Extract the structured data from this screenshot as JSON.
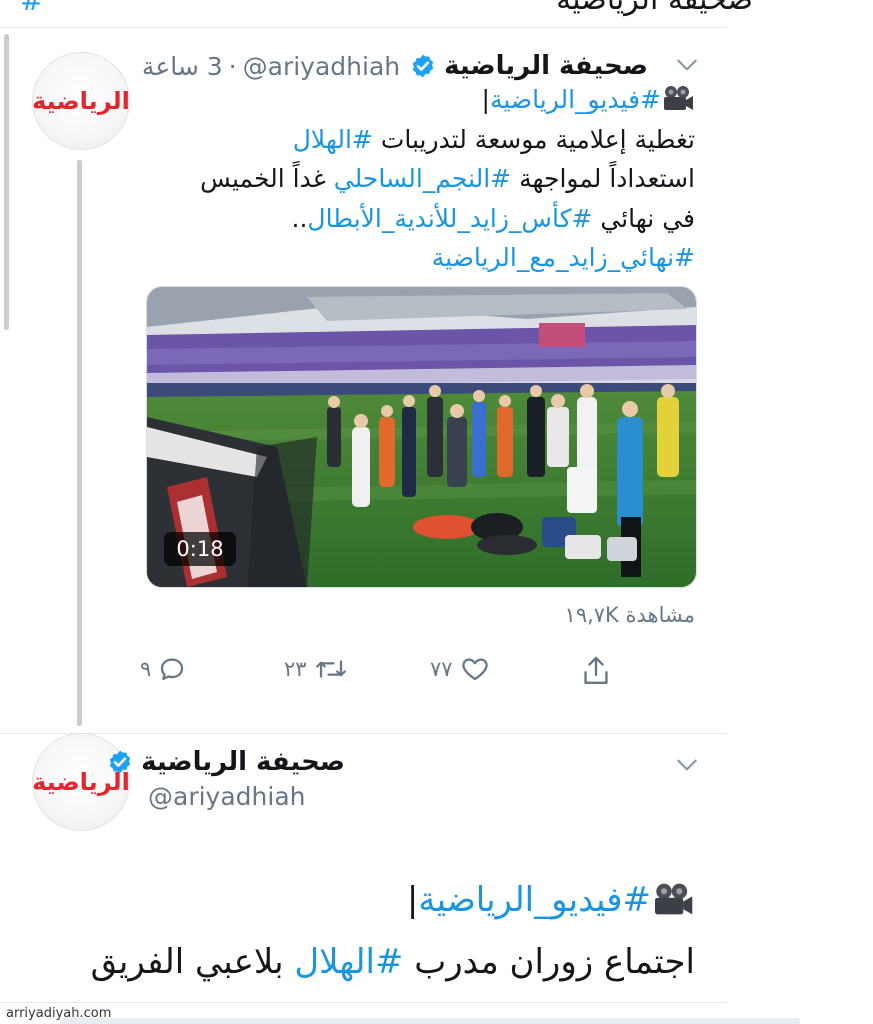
{
  "top_strip": {
    "partial_text": "صحيفة الرياضية",
    "partial_link": "#"
  },
  "tweet1": {
    "display_name": "صحيفة الرياضية",
    "handle": "@ariyadhiah",
    "separator": "·",
    "time": "3 ساعة",
    "avatar_logo": "الرياضية",
    "line1_hashtag": "#فيديو_الرياضية",
    "line1_bar": "|",
    "line2_text": "تغطية إعلامية موسعة لتدريبات ",
    "line2_hashtag": "#الهلال",
    "line3_text_a": "استعداداً لمواجهة ",
    "line3_hashtag": "#النجم_الساحلي",
    "line3_text_b": " غداً الخميس",
    "line4_text_a": "في نهائي ",
    "line4_hashtag": "#كأس_زايد_للأندية_الأبطال",
    "line4_text_b": "..",
    "line5_hashtag": "#نهائي_زايد_مع_الرياضية",
    "video_duration": "0:18",
    "views": "مشاهدة ١٩,٧K",
    "reply_count": "٩",
    "retweet_count": "٢٣",
    "like_count": "٧٧"
  },
  "tweet2": {
    "display_name": "صحيفة الرياضية",
    "handle": "@ariyadhiah",
    "avatar_logo": "الرياضية",
    "line1_hashtag": "#فيديو_الرياضية",
    "line1_bar": "|",
    "line2_text_a": "اجتماع زوران مدرب ",
    "line2_hashtag": "#الهلال",
    "line2_text_b": " بلاعبي الفريق"
  },
  "watermark": "arriyadiyah.com",
  "colors": {
    "link": "#1b95e0",
    "muted": "#657786",
    "verified": "#1da1f2",
    "logo_red": "#e0272f"
  },
  "icons": [
    "verified-badge-icon",
    "chevron-down-icon",
    "movie-camera-icon",
    "reply-icon",
    "retweet-icon",
    "like-icon",
    "share-icon"
  ]
}
